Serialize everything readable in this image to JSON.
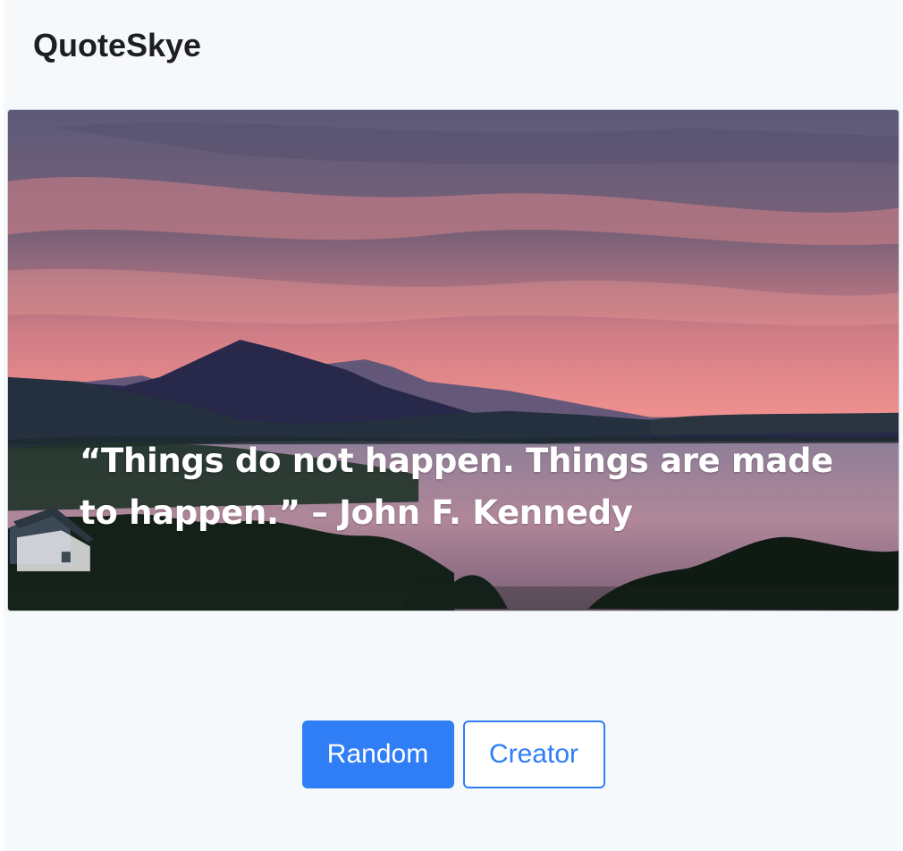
{
  "app": {
    "brand": "QuoteSkye"
  },
  "quote_card": {
    "text": "“Things do not happen. Things are made to happen.” – John F. Kennedy"
  },
  "actions": {
    "random_label": "Random",
    "creator_label": "Creator"
  },
  "colors": {
    "accent": "#2f7ef6",
    "navbar_bg": "#f7f8f9",
    "page_bg": "#f6f9fb"
  }
}
